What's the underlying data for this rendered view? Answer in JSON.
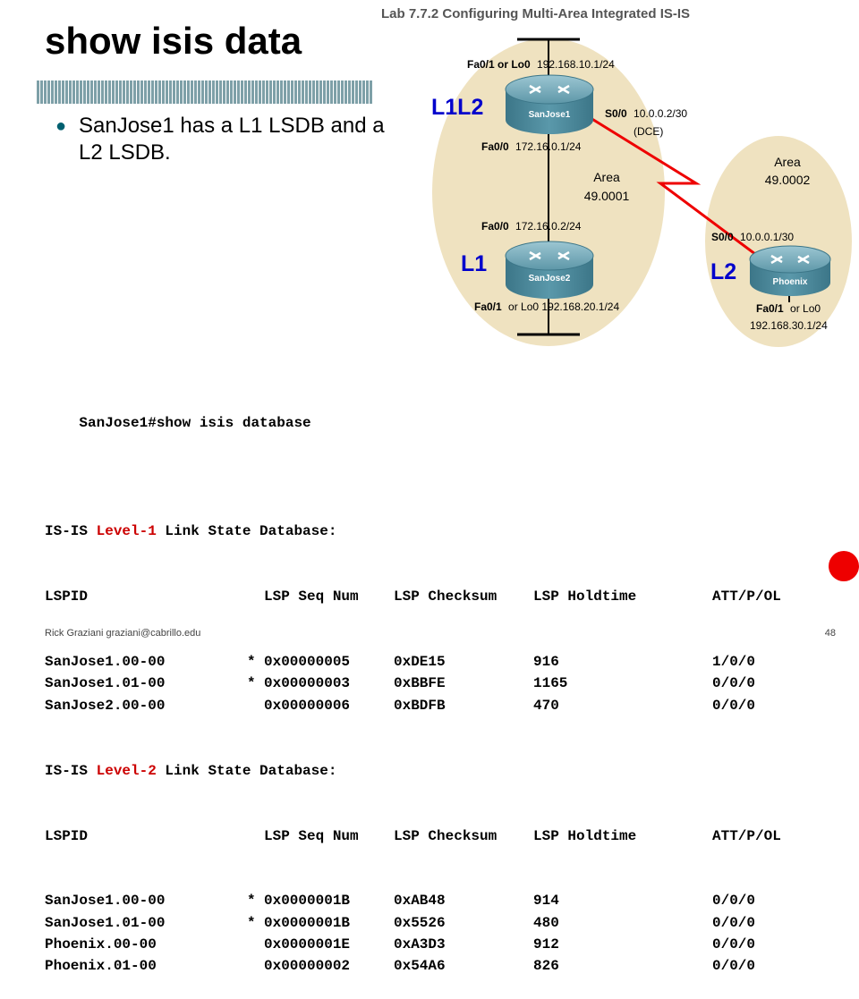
{
  "slide": {
    "title": "show isis data",
    "bullet": "SanJose1 has a L1 LSDB and a L2 LSDB.",
    "footer": "Rick Graziani  graziani@cabrillo.edu",
    "page_number": "48"
  },
  "diagram": {
    "lab_title": "Lab 7.7.2 Configuring Multi-Area Integrated IS-IS",
    "sj1_fa01": "Fa0/1 or Lo0",
    "sj1_fa01_ip": "192.168.10.1/24",
    "sj1_name": "SanJose1",
    "sj1_s00": "S0/0",
    "sj1_s00_ip": "10.0.0.2/30",
    "dce": "(DCE)",
    "sj1_fa00": "Fa0/0",
    "sj1_fa00_ip": "172.16.0.1/24",
    "area1_label": "Area",
    "area1_id": "49.0001",
    "sj2_fa00": "Fa0/0",
    "sj2_fa00_ip": "172.16.0.2/24",
    "sj2_name": "SanJose2",
    "sj2_fa01": "Fa0/1",
    "sj2_fa01_ip": "or Lo0 192.168.20.1/24",
    "area2_label": "Area",
    "area2_id": "49.0002",
    "ph_s00": "S0/0",
    "ph_s00_ip": "10.0.0.1/30",
    "ph_name": "Phoenix",
    "ph_fa01": "Fa0/1",
    "ph_fa01_or": "or Lo0",
    "ph_fa01_ip": "192.168.30.1/24",
    "tag_sj1": "L1L2",
    "tag_sj2": "L1",
    "tag_ph": "L2",
    "colors": {
      "level_tag": "#0000cc",
      "serial_link": "#ee0000",
      "area_fill": "#efe2c0",
      "router_body": "#4f8ea0"
    }
  },
  "cli": {
    "command": "SanJose1#show isis database",
    "level1_prefix": "IS-IS ",
    "level1_word": "Level-1",
    "level1_suffix": " Link State Database:",
    "level2_prefix": "IS-IS ",
    "level2_word": "Level-2",
    "level2_suffix": " Link State Database:",
    "headers": [
      "LSPID",
      "LSP Seq Num",
      "LSP Checksum",
      "LSP Holdtime",
      "ATT/P/OL"
    ],
    "level1_rows": [
      {
        "lspid": "SanJose1.00-00",
        "mark": "*",
        "seq": "0x00000005",
        "checksum": "0xDE15",
        "holdtime": "916",
        "attpol": "1/0/0"
      },
      {
        "lspid": "SanJose1.01-00",
        "mark": "*",
        "seq": "0x00000003",
        "checksum": "0xBBFE",
        "holdtime": "1165",
        "attpol": "0/0/0"
      },
      {
        "lspid": "SanJose2.00-00",
        "mark": "",
        "seq": "0x00000006",
        "checksum": "0xBDFB",
        "holdtime": "470",
        "attpol": "0/0/0"
      }
    ],
    "level2_rows": [
      {
        "lspid": "SanJose1.00-00",
        "mark": "*",
        "seq": "0x0000001B",
        "checksum": "0xAB48",
        "holdtime": "914",
        "attpol": "0/0/0"
      },
      {
        "lspid": "SanJose1.01-00",
        "mark": "*",
        "seq": "0x0000001B",
        "checksum": "0x5526",
        "holdtime": "480",
        "attpol": "0/0/0"
      },
      {
        "lspid": "Phoenix.00-00",
        "mark": "",
        "seq": "0x0000001E",
        "checksum": "0xA3D3",
        "holdtime": "912",
        "attpol": "0/0/0"
      },
      {
        "lspid": "Phoenix.01-00",
        "mark": "",
        "seq": "0x00000002",
        "checksum": "0x54A6",
        "holdtime": "826",
        "attpol": "0/0/0"
      }
    ]
  }
}
